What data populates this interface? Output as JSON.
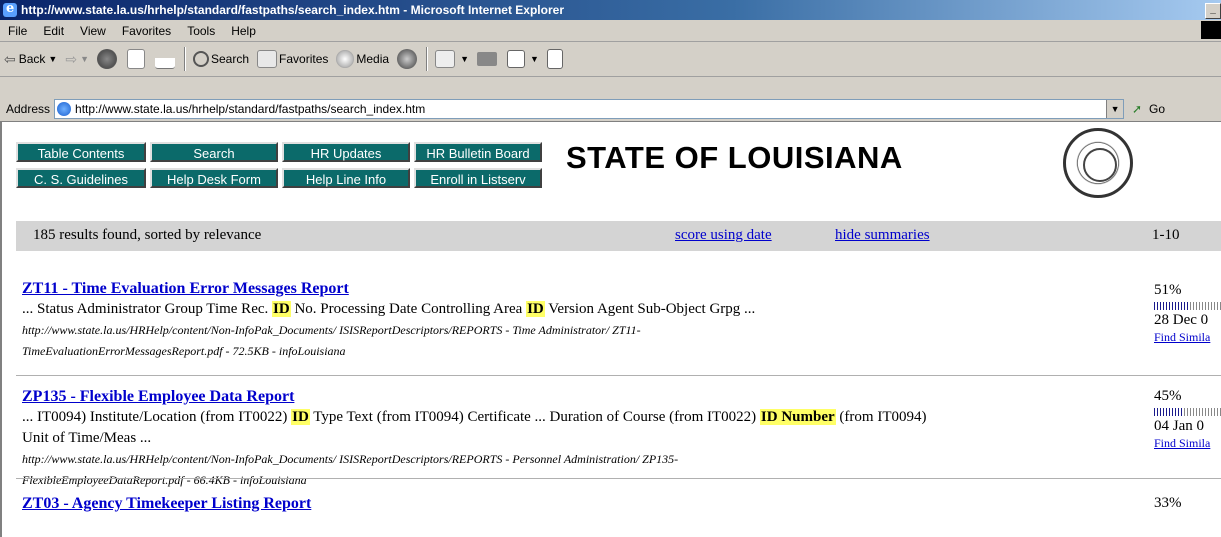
{
  "window": {
    "title": "http://www.state.la.us/hrhelp/standard/fastpaths/search_index.htm - Microsoft Internet Explorer"
  },
  "menu": [
    "File",
    "Edit",
    "View",
    "Favorites",
    "Tools",
    "Help"
  ],
  "toolbar": {
    "back": "Back",
    "search": "Search",
    "favorites": "Favorites",
    "media": "Media"
  },
  "address": {
    "label": "Address",
    "url": "http://www.state.la.us/hrhelp/standard/fastpaths/search_index.htm",
    "go": "Go"
  },
  "nav_buttons": [
    "Table Contents",
    "Search",
    "HR Updates",
    "HR Bulletin Board",
    "C. S. Guidelines",
    "Help Desk Form",
    "Help Line Info",
    "Enroll in Listserv"
  ],
  "page": {
    "state_title": "STATE OF LOUISIANA"
  },
  "results_bar": {
    "count_text": "185 results found, sorted by relevance",
    "score_link": "score using date",
    "hide_link": "hide summaries",
    "range": "1-10"
  },
  "results": [
    {
      "title": "ZT11 - Time Evaluation Error Messages Report",
      "snippet_parts": [
        "... Status Administrator Group Time Rec. ",
        "ID",
        " No. Processing Date Controlling Area ",
        "ID",
        " Version Agent Sub-Object Grpg ..."
      ],
      "url_line1": "http://www.state.la.us/HRHelp/content/Non-InfoPak_Documents/ ISISReportDescriptors/REPORTS - Time Administrator/ ZT11-",
      "url_line2": "TimeEvaluationErrorMessagesReport.pdf - 72.5KB - infoLouisiana",
      "score": "51%",
      "score_value": 51,
      "date": "28 Dec 0",
      "similar": "Find Simila"
    },
    {
      "title": "ZP135 - Flexible Employee Data Report",
      "snippet_parts": [
        "... IT0094) Institute/Location (from IT0022) ",
        "ID",
        " Type Text (from IT0094) Certificate ... Duration of Course (from IT0022) ",
        "ID Number",
        " (from IT0094)"
      ],
      "snippet_line2": "Unit of Time/Meas ...",
      "url_line1": "http://www.state.la.us/HRHelp/content/Non-InfoPak_Documents/ ISISReportDescriptors/REPORTS - Personnel Administration/ ZP135-",
      "url_line2": "FlexibleEmployeeDataReport.pdf - 66.4KB - infoLouisiana",
      "score": "45%",
      "score_value": 45,
      "date": "04 Jan 0",
      "similar": "Find Simila"
    },
    {
      "title": "ZT03 - Agency Timekeeper Listing Report",
      "score": "33%",
      "score_value": 33
    }
  ]
}
